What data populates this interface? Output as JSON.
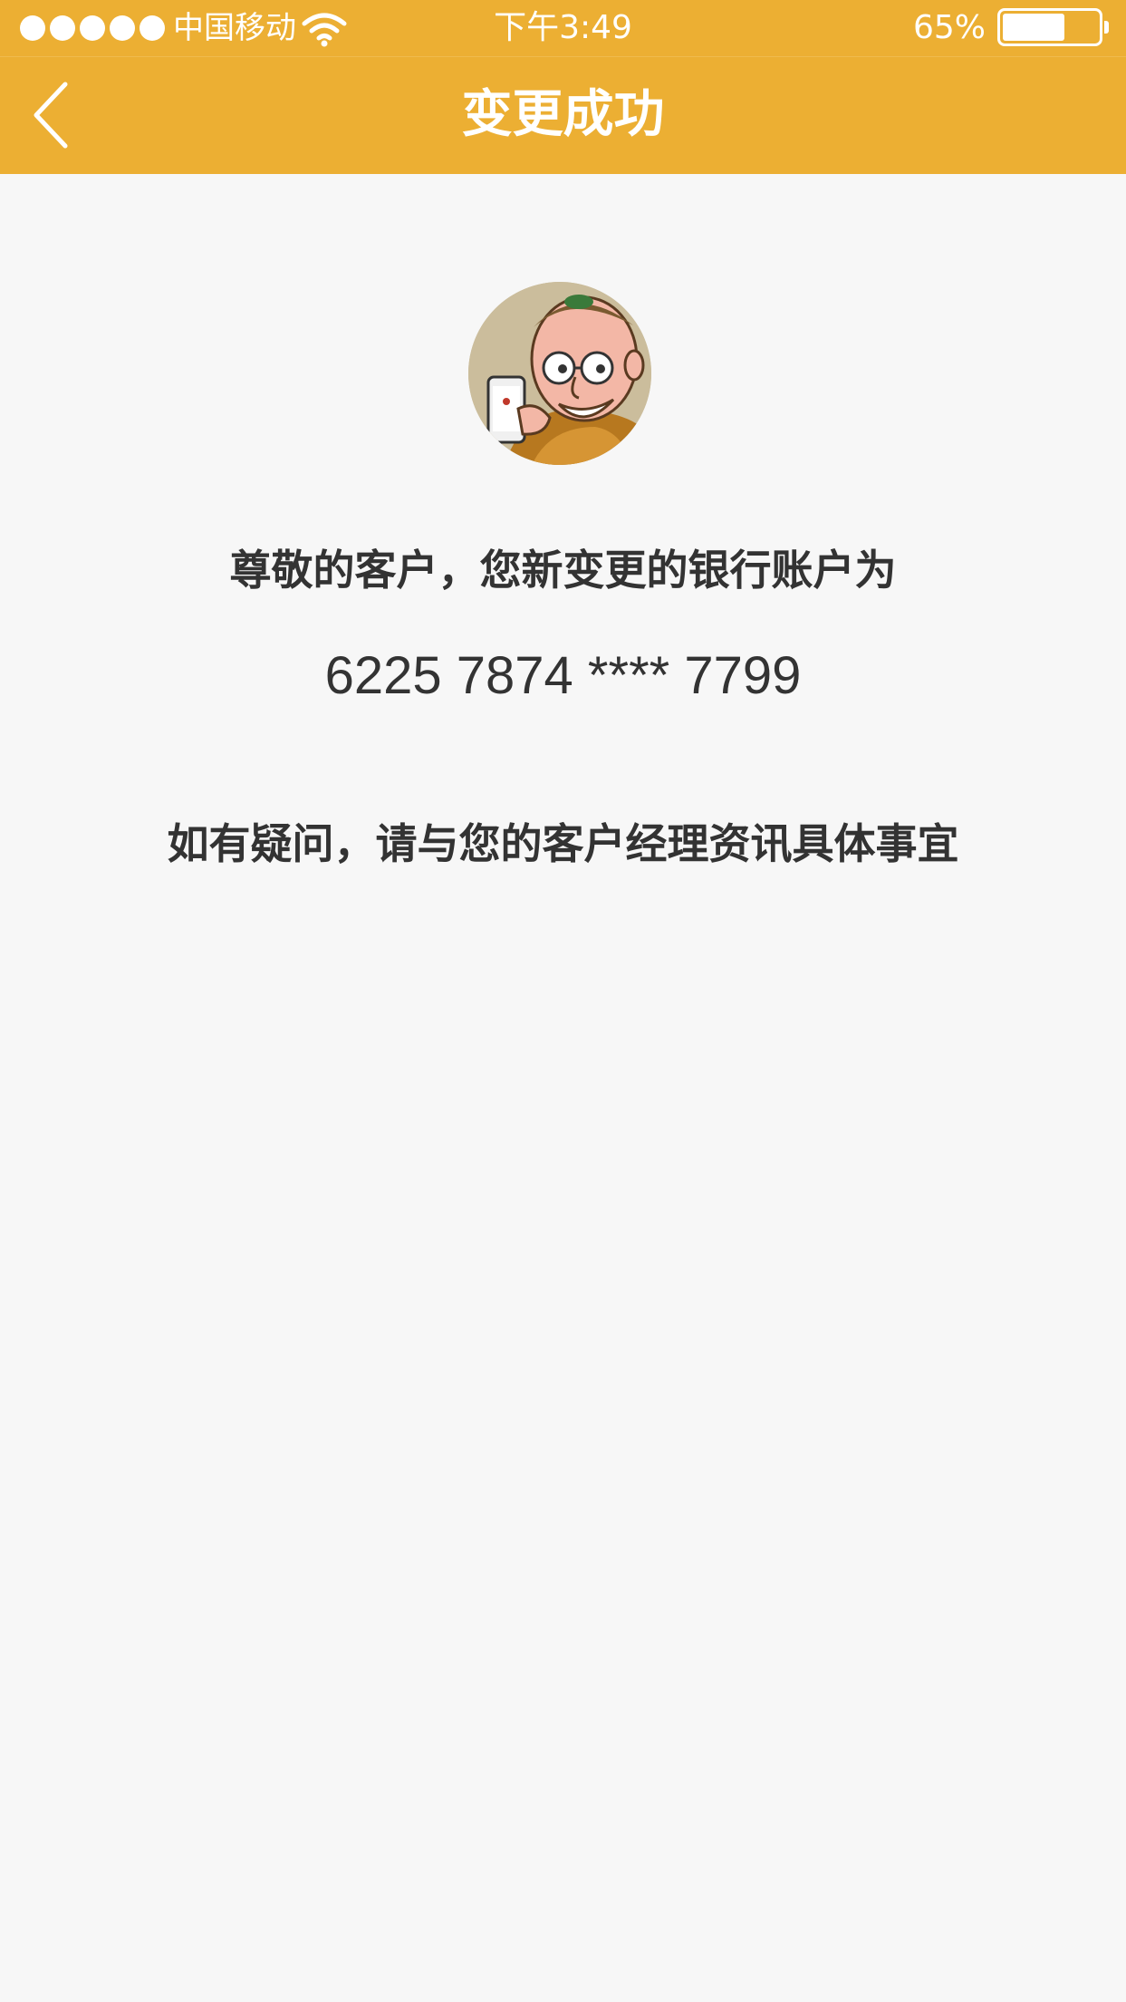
{
  "status_bar": {
    "carrier": "中国移动",
    "time": "下午3:49",
    "battery_percent_label": "65%",
    "battery_level": 0.65,
    "signal_bars": 5,
    "icons": [
      "signal-dots-icon",
      "wifi-icon",
      "battery-icon"
    ]
  },
  "nav": {
    "title": "变更成功",
    "back_icon": "chevron-left-icon"
  },
  "content": {
    "avatar_icon": "cartoon-avatar",
    "message": "尊敬的客户，您新变更的银行账户为",
    "account_number": "6225 7874 **** 7799",
    "hint": "如有疑问，请与您的客户经理资讯具体事宜"
  },
  "colors": {
    "accent": "#ecaf33",
    "background": "#f7f7f7",
    "text": "#333333"
  }
}
